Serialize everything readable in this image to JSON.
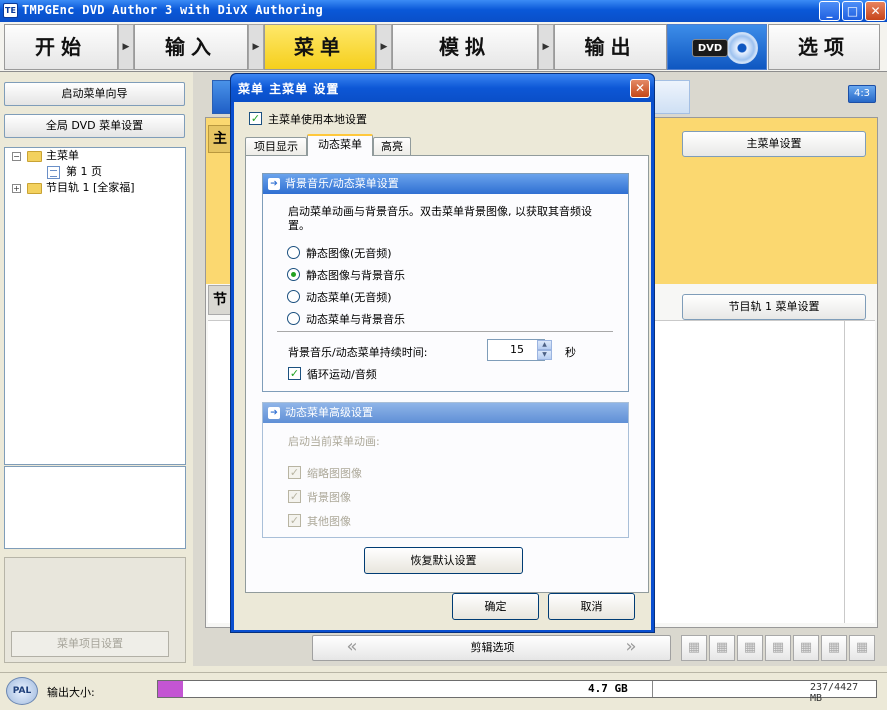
{
  "app": {
    "title": "TMPGEnc DVD Author 3 with DivX Authoring",
    "icon_text": "TE",
    "window_controls": {
      "minimize": "_",
      "maximize": "□",
      "close": "✕"
    }
  },
  "nav": {
    "start": "开始",
    "input": "输入",
    "menu": "菜单",
    "simulate": "模拟",
    "output": "输出",
    "dvd": "DVD",
    "options": "选项",
    "arrow": "▶"
  },
  "left": {
    "wizard_button": "启动菜单向导",
    "global_settings_button": "全局 DVD 菜单设置",
    "tree": {
      "main_menu": "主菜单",
      "page1": "第 1 页",
      "track1": "节目轨 1 [全家福]",
      "collapse": "−",
      "expand": "+"
    },
    "menu_item_settings": "菜单项目设置"
  },
  "main": {
    "ratio_badge": "4:3",
    "main_section_label": "主",
    "track_section_label": "节",
    "main_menu_settings": "主菜单设置",
    "track1_menu_settings": "节目轨 1 菜单设置",
    "edit_options": "剪辑选项",
    "edit_prev": "«",
    "edit_next": "»",
    "view_icon_glyph": "▦"
  },
  "status": {
    "pal": "PAL",
    "output_size_label": "输出大小:",
    "capacity": "4.7 GB",
    "used": "237/4427 MB",
    "used_fraction": 0.035
  },
  "dialog": {
    "title": "菜单 主菜单 设置",
    "close": "✕",
    "use_local_settings": "主菜单使用本地设置",
    "checkmark": "✓",
    "tabs": {
      "item_display": "项目显示",
      "dynamic_menu": "动态菜单",
      "highlight": "高亮"
    },
    "bgm_group": {
      "header": "背景音乐/动态菜单设置",
      "header_icon": "➔",
      "description": "启动菜单动画与背景音乐。双击菜单背景图像, 以获取其音频设置。",
      "options": [
        "静态图像(无音频)",
        "静态图像与背景音乐",
        "动态菜单(无音频)",
        "动态菜单与背景音乐"
      ],
      "selected_index": 1,
      "duration_label": "背景音乐/动态菜单持续时间:",
      "duration_value": "15",
      "duration_unit": "秒",
      "spin_up": "▲",
      "spin_down": "▼",
      "loop_label": "循环运动/音频"
    },
    "advanced_group": {
      "header": "动态菜单高级设置",
      "header_icon": "➔",
      "start_animation_label": "启动当前菜单动画:",
      "thumbnail": "缩略图图像",
      "background": "背景图像",
      "other": "其他图像"
    },
    "restore_defaults": "恢复默认设置",
    "ok": "确定",
    "cancel": "取消"
  }
}
